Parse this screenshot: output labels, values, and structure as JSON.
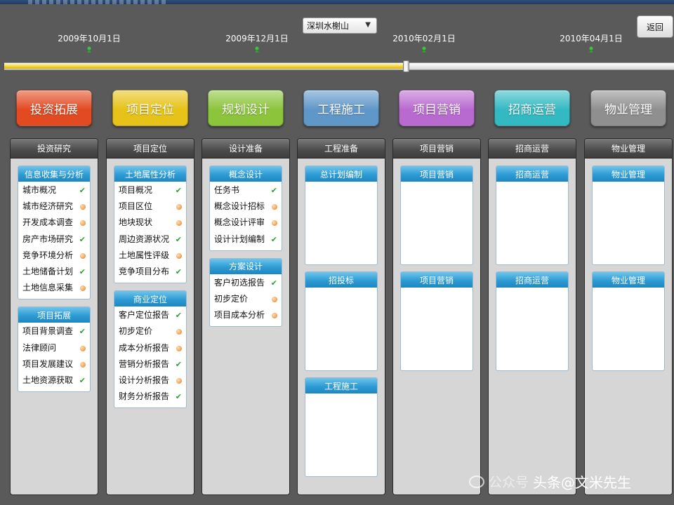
{
  "header": {
    "city_select": "深圳水榭山",
    "back_label": "返回"
  },
  "timeline": {
    "dates": [
      "2009年10月1日",
      "2009年12月1日",
      "2010年02月1日",
      "2010年04月1日"
    ],
    "progress": 0.6
  },
  "phases": [
    {
      "label": "投资拓展",
      "color": "#e24a22"
    },
    {
      "label": "项目定位",
      "color": "#e7c218"
    },
    {
      "label": "规划设计",
      "color": "#8cc43c"
    },
    {
      "label": "工程施工",
      "color": "#5f97c8"
    },
    {
      "label": "项目营销",
      "color": "#b96ad0"
    },
    {
      "label": "招商运营",
      "color": "#33b9c2"
    },
    {
      "label": "物业管理",
      "color": "#8f8f8f"
    }
  ],
  "columns": [
    {
      "header": "投资研究",
      "cards": [
        {
          "title": "信息收集与分析",
          "items": [
            {
              "label": "城市概况",
              "status": "done"
            },
            {
              "label": "城市经济研究",
              "status": "pending"
            },
            {
              "label": "开发成本调查",
              "status": "pending"
            },
            {
              "label": "房产市场研究",
              "status": "done"
            },
            {
              "label": "竞争环境分析",
              "status": "pending"
            },
            {
              "label": "土地储备计划",
              "status": "done"
            },
            {
              "label": "土地信息采集",
              "status": "pending"
            }
          ]
        },
        {
          "title": "项目拓展",
          "items": [
            {
              "label": "项目背景调查",
              "status": "done"
            },
            {
              "label": "法律顾问",
              "status": "pending"
            },
            {
              "label": "项目发展建议",
              "status": "pending"
            },
            {
              "label": "土地资源获取",
              "status": "done"
            }
          ]
        }
      ]
    },
    {
      "header": "项目定位",
      "cards": [
        {
          "title": "土地属性分析",
          "items": [
            {
              "label": "项目概况",
              "status": "done"
            },
            {
              "label": "项目区位",
              "status": "pending"
            },
            {
              "label": "地块现状",
              "status": "pending"
            },
            {
              "label": "周边资源状况",
              "status": "done"
            },
            {
              "label": "土地属性评级",
              "status": "pending"
            },
            {
              "label": "竞争项目分布",
              "status": "done"
            }
          ]
        },
        {
          "title": "商业定位",
          "items": [
            {
              "label": "客户定位报告",
              "status": "done"
            },
            {
              "label": "初步定价",
              "status": "pending"
            },
            {
              "label": "成本分析报告",
              "status": "pending"
            },
            {
              "label": "营销分析报告",
              "status": "done"
            },
            {
              "label": "设计分析报告",
              "status": "pending"
            },
            {
              "label": "财务分析报告",
              "status": "done"
            }
          ]
        }
      ]
    },
    {
      "header": "设计准备",
      "cards": [
        {
          "title": "概念设计",
          "items": [
            {
              "label": "任务书",
              "status": "done"
            },
            {
              "label": "概念设计招标",
              "status": "pending"
            },
            {
              "label": "概念设计评审",
              "status": "pending"
            },
            {
              "label": "设计计划编制",
              "status": "done"
            }
          ]
        },
        {
          "title": "方案设计",
          "items": [
            {
              "label": "客户初选报告",
              "status": "done"
            },
            {
              "label": "初步定价",
              "status": "pending"
            },
            {
              "label": "项目成本分析",
              "status": "pending"
            }
          ]
        }
      ]
    },
    {
      "header": "工程准备",
      "cards": [
        {
          "title": "总计划编制",
          "items": []
        },
        {
          "title": "招投标",
          "items": []
        },
        {
          "title": "工程施工",
          "items": []
        }
      ]
    },
    {
      "header": "项目营销",
      "cards": [
        {
          "title": "项目营销",
          "items": []
        },
        {
          "title": "项目营销",
          "items": []
        }
      ]
    },
    {
      "header": "招商运营",
      "cards": [
        {
          "title": "招商运营",
          "items": []
        },
        {
          "title": "招商运营",
          "items": []
        }
      ]
    },
    {
      "header": "物业管理",
      "cards": [
        {
          "title": "物业管理",
          "items": []
        },
        {
          "title": "物业管理",
          "items": []
        }
      ]
    }
  ],
  "watermark": {
    "ghost": "公众号",
    "text": "头条@文米先生"
  },
  "colors": {
    "done_check": "#2ea12e",
    "pending_dot": "#f3a45a",
    "card_title": "#2d9bd4"
  }
}
